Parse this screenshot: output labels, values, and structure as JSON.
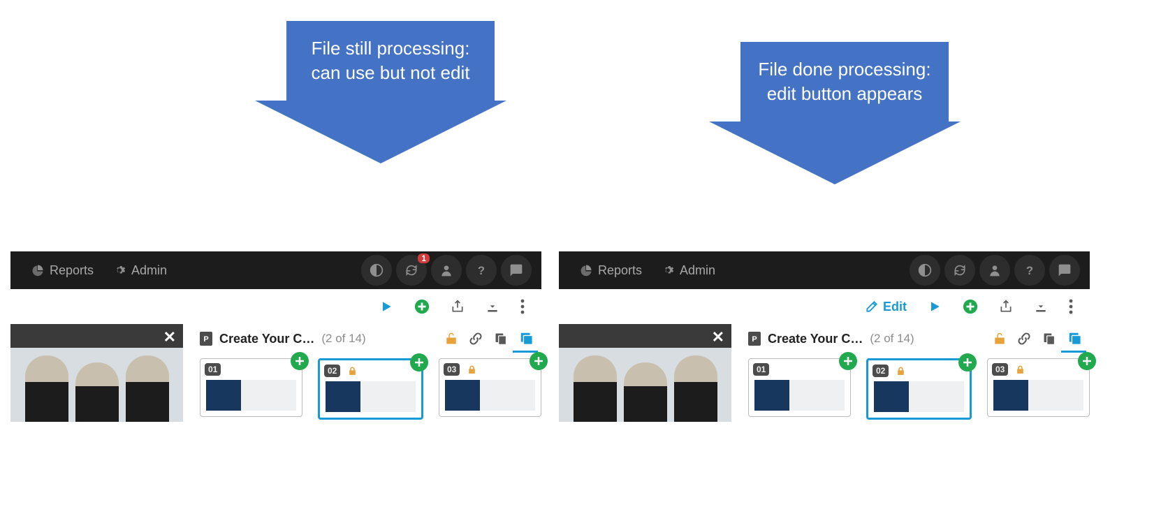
{
  "callouts": {
    "left": "File still processing: can use but not edit",
    "right": "File done processing: edit button appears"
  },
  "nav": {
    "reports": "Reports",
    "admin": "Admin"
  },
  "notification_badge": "1",
  "edit_label": "Edit",
  "file": {
    "title": "Create Your C…",
    "count": "(2 of 14)"
  },
  "slides": {
    "s1": "01",
    "s2": "02",
    "s3": "03"
  },
  "icons": {
    "pie": "pie-chart-icon",
    "gear": "gear-icon",
    "contrast": "contrast-icon",
    "sync": "sync-icon",
    "user": "user-icon",
    "help": "help-icon",
    "chat": "chat-icon",
    "play": "play-icon",
    "add": "add-circle-icon",
    "share": "share-icon",
    "download": "download-icon",
    "more": "more-vert-icon",
    "close": "close-icon",
    "presentation": "presentation-file-icon",
    "unlock": "unlock-icon",
    "link": "link-icon",
    "copy": "copy-icon",
    "stack": "stack-icon",
    "lock": "lock-icon",
    "edit": "edit-icon",
    "plus": "plus-icon"
  }
}
